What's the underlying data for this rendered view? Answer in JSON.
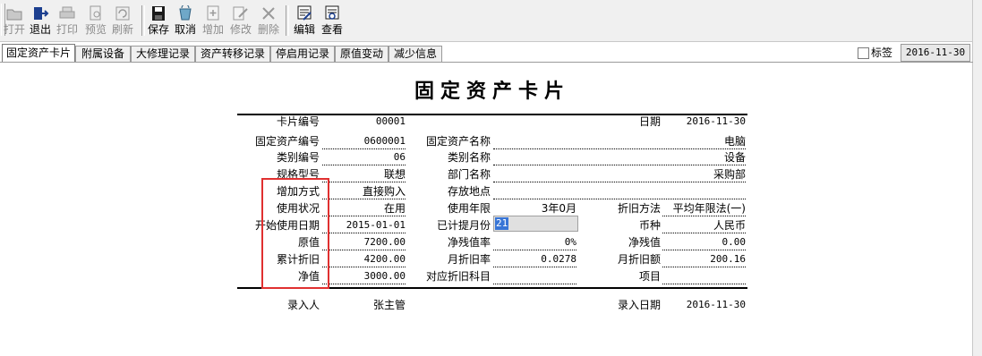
{
  "toolbar": {
    "buttons": [
      {
        "id": "open",
        "label": "打开",
        "icon": "open-folder-icon",
        "enabled": false
      },
      {
        "id": "exit",
        "label": "退出",
        "icon": "exit-door-icon",
        "enabled": true
      },
      {
        "id": "print",
        "label": "打印",
        "icon": "printer-icon",
        "enabled": false
      },
      {
        "id": "preview",
        "label": "预览",
        "icon": "print-preview-icon",
        "enabled": false
      },
      {
        "id": "refresh",
        "label": "刷新",
        "icon": "refresh-icon",
        "enabled": false
      },
      {
        "id": "save",
        "label": "保存",
        "icon": "floppy-disk-icon",
        "enabled": true
      },
      {
        "id": "cancel",
        "label": "取消",
        "icon": "undo-cancel-icon",
        "enabled": true
      },
      {
        "id": "add",
        "label": "增加",
        "icon": "add-document-icon",
        "enabled": false
      },
      {
        "id": "modify",
        "label": "修改",
        "icon": "edit-pencil-icon",
        "enabled": false
      },
      {
        "id": "delete",
        "label": "删除",
        "icon": "delete-x-icon",
        "enabled": false
      },
      {
        "id": "edit",
        "label": "编辑",
        "icon": "edit-card-icon",
        "enabled": true
      },
      {
        "id": "view",
        "label": "查看",
        "icon": "view-card-icon",
        "enabled": true
      }
    ]
  },
  "tabs": [
    "固定资产卡片",
    "附属设备",
    "大修理记录",
    "资产转移记录",
    "停启用记录",
    "原值变动",
    "减少信息"
  ],
  "active_tab": "固定资产卡片",
  "tag_checkbox": {
    "label": "标签",
    "checked": false
  },
  "header_date": "2016-11-30",
  "card": {
    "title": "固定资产卡片",
    "card_no_label": "卡片编号",
    "card_no": "00001",
    "date_label": "日期",
    "date": "2016-11-30",
    "left": [
      {
        "label": "固定资产编号",
        "value": "0600001"
      },
      {
        "label": "类别编号",
        "value": "06"
      },
      {
        "label": "规格型号",
        "value": "联想"
      },
      {
        "label": "增加方式",
        "value": "直接购入"
      },
      {
        "label": "使用状况",
        "value": "在用"
      },
      {
        "label": "开始使用日期",
        "value": "2015-01-01"
      },
      {
        "label": "原值",
        "value": "7200.00"
      },
      {
        "label": "累计折旧",
        "value": "4200.00"
      },
      {
        "label": "净值",
        "value": "3000.00"
      }
    ],
    "asset_name_label": "固定资产名称",
    "asset_name": "电脑",
    "category_name_label": "类别名称",
    "category_name": "设备",
    "department_label": "部门名称",
    "department": "采购部",
    "location_label": "存放地点",
    "location": "",
    "useful_life_label": "使用年限",
    "useful_life": "3年0月",
    "depr_method_label": "折旧方法",
    "depr_method": "平均年限法(一)",
    "months_depr_label": "已计提月份",
    "months_depr": "21",
    "currency_label": "币种",
    "currency": "人民币",
    "salvage_rate_label": "净残值率",
    "salvage_rate": "0%",
    "salvage_value_label": "净残值",
    "salvage_value": "0.00",
    "monthly_rate_label": "月折旧率",
    "monthly_rate": "0.0278",
    "monthly_amount_label": "月折旧额",
    "monthly_amount": "200.16",
    "depr_account_label": "对应折旧科目",
    "depr_account": "",
    "item_label": "项目",
    "item": "",
    "entered_by_label": "录入人",
    "entered_by": "张主管",
    "entry_date_label": "录入日期",
    "entry_date": "2016-11-30"
  },
  "colors": {
    "highlight_box": "#e03030",
    "selection": "#3875d6",
    "toolbar_bg": "#f0f0f0"
  }
}
